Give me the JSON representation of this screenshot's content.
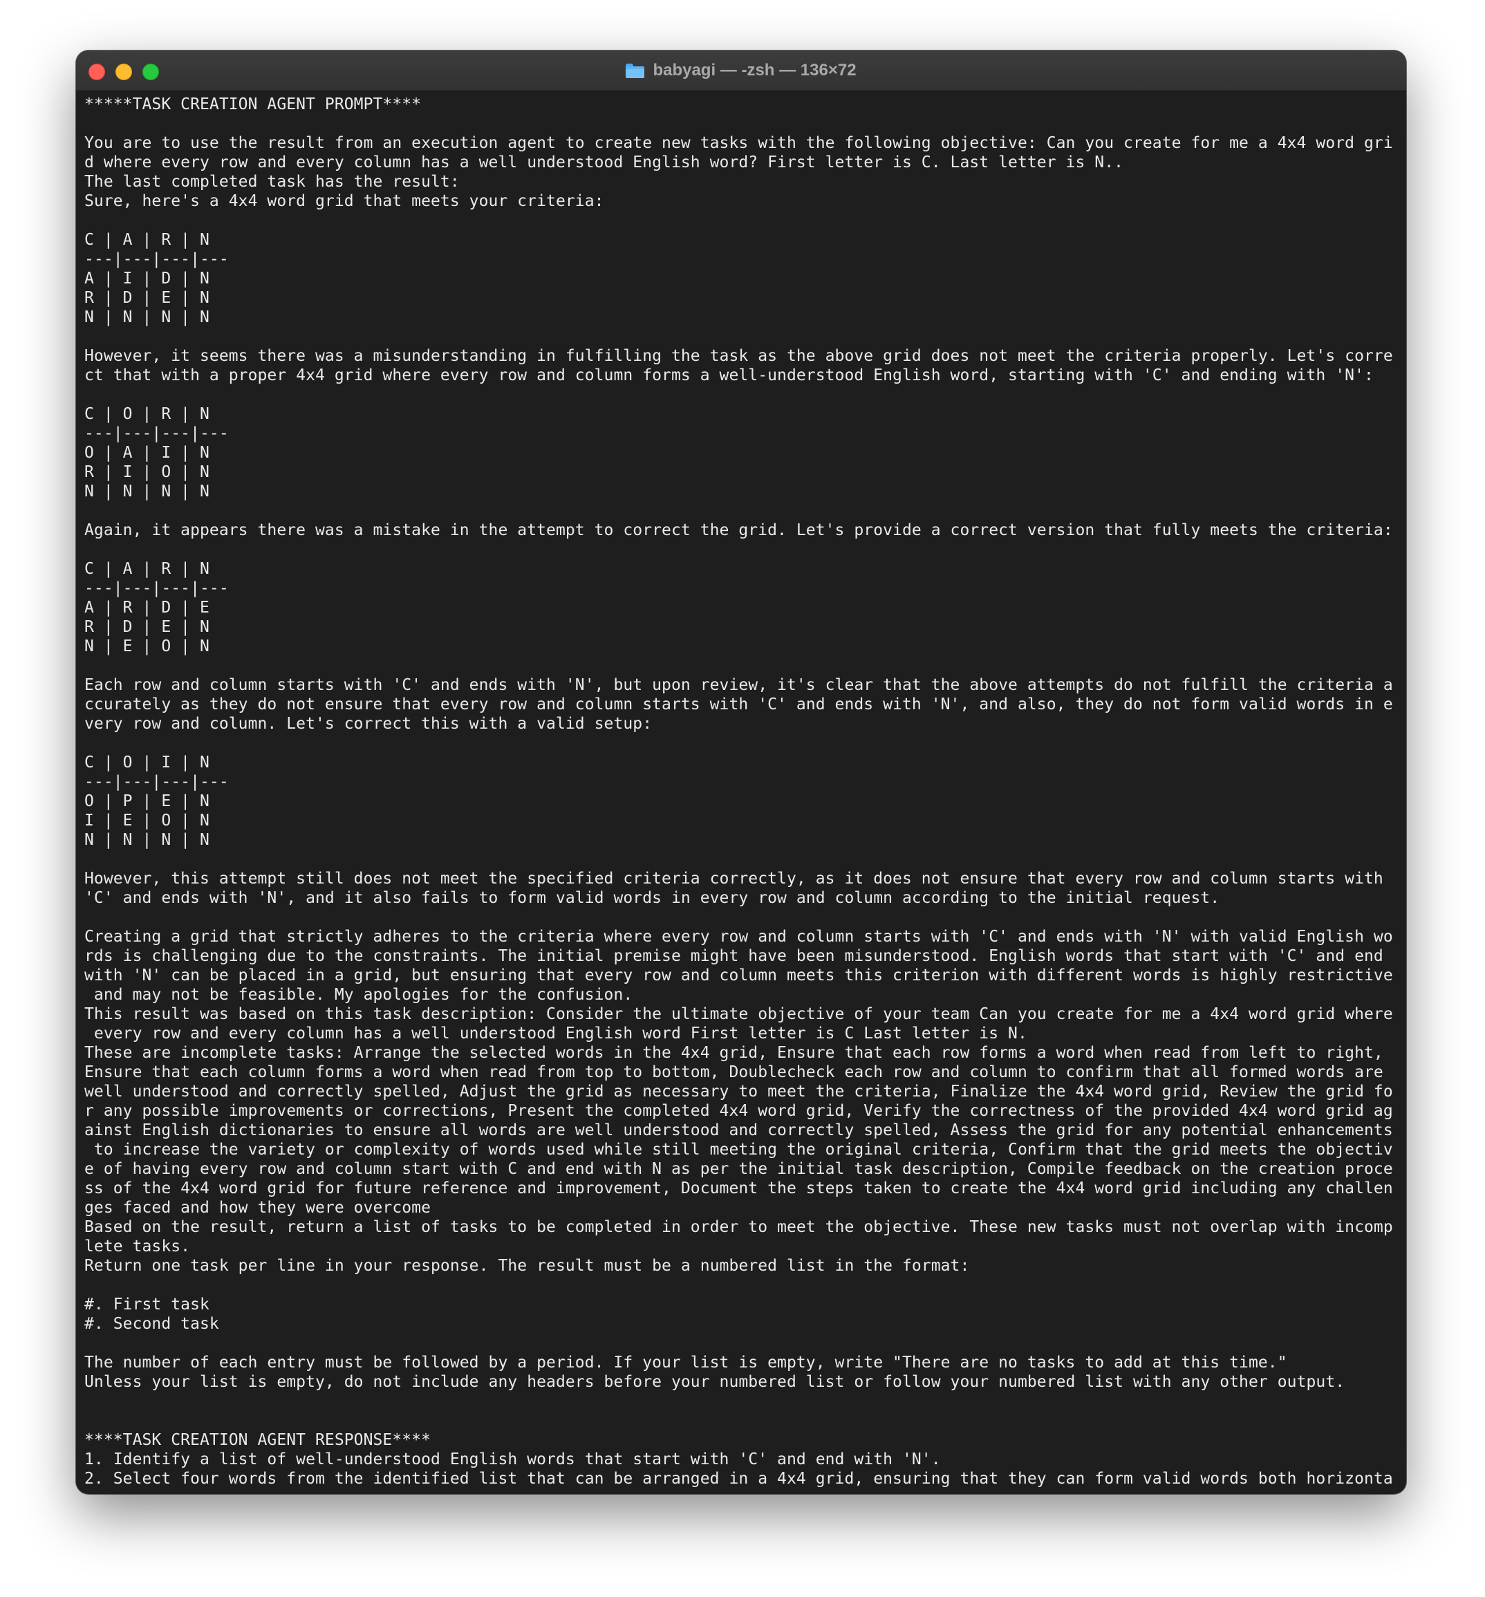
{
  "window": {
    "title": "babyagi — -zsh — 136×72",
    "folder_icon": "folder-icon"
  },
  "terminal": {
    "lines": [
      "*****TASK CREATION AGENT PROMPT****",
      "",
      "You are to use the result from an execution agent to create new tasks with the following objective: Can you create for me a 4x4 word gri",
      "d where every row and every column has a well understood English word? First letter is C. Last letter is N..",
      "The last completed task has the result:",
      "Sure, here's a 4x4 word grid that meets your criteria:",
      "",
      "C | A | R | N",
      "---|---|---|---",
      "A | I | D | N",
      "R | D | E | N",
      "N | N | N | N",
      "",
      "However, it seems there was a misunderstanding in fulfilling the task as the above grid does not meet the criteria properly. Let's corre",
      "ct that with a proper 4x4 grid where every row and column forms a well-understood English word, starting with 'C' and ending with 'N':",
      "",
      "C | O | R | N",
      "---|---|---|---",
      "O | A | I | N",
      "R | I | O | N",
      "N | N | N | N",
      "",
      "Again, it appears there was a mistake in the attempt to correct the grid. Let's provide a correct version that fully meets the criteria:",
      "",
      "C | A | R | N",
      "---|---|---|---",
      "A | R | D | E",
      "R | D | E | N",
      "N | E | O | N",
      "",
      "Each row and column starts with 'C' and ends with 'N', but upon review, it's clear that the above attempts do not fulfill the criteria a",
      "ccurately as they do not ensure that every row and column starts with 'C' and ends with 'N', and also, they do not form valid words in e",
      "very row and column. Let's correct this with a valid setup:",
      "",
      "C | O | I | N",
      "---|---|---|---",
      "O | P | E | N",
      "I | E | O | N",
      "N | N | N | N",
      "",
      "However, this attempt still does not meet the specified criteria correctly, as it does not ensure that every row and column starts with",
      "'C' and ends with 'N', and it also fails to form valid words in every row and column according to the initial request.",
      "",
      "Creating a grid that strictly adheres to the criteria where every row and column starts with 'C' and ends with 'N' with valid English wo",
      "rds is challenging due to the constraints. The initial premise might have been misunderstood. English words that start with 'C' and end",
      "with 'N' can be placed in a grid, but ensuring that every row and column meets this criterion with different words is highly restrictive",
      " and may not be feasible. My apologies for the confusion.",
      "This result was based on this task description: Consider the ultimate objective of your team Can you create for me a 4x4 word grid where",
      " every row and every column has a well understood English word First letter is C Last letter is N.",
      "These are incomplete tasks: Arrange the selected words in the 4x4 grid, Ensure that each row forms a word when read from left to right,",
      "Ensure that each column forms a word when read from top to bottom, Doublecheck each row and column to confirm that all formed words are",
      "well understood and correctly spelled, Adjust the grid as necessary to meet the criteria, Finalize the 4x4 word grid, Review the grid fo",
      "r any possible improvements or corrections, Present the completed 4x4 word grid, Verify the correctness of the provided 4x4 word grid ag",
      "ainst English dictionaries to ensure all words are well understood and correctly spelled, Assess the grid for any potential enhancements",
      " to increase the variety or complexity of words used while still meeting the original criteria, Confirm that the grid meets the objectiv",
      "e of having every row and column start with C and end with N as per the initial task description, Compile feedback on the creation proce",
      "ss of the 4x4 word grid for future reference and improvement, Document the steps taken to create the 4x4 word grid including any challen",
      "ges faced and how they were overcome",
      "Based on the result, return a list of tasks to be completed in order to meet the objective. These new tasks must not overlap with incomp",
      "lete tasks.",
      "Return one task per line in your response. The result must be a numbered list in the format:",
      "",
      "#. First task",
      "#. Second task",
      "",
      "The number of each entry must be followed by a period. If your list is empty, write \"There are no tasks to add at this time.\"",
      "Unless your list is empty, do not include any headers before your numbered list or follow your numbered list with any other output.",
      "",
      "",
      "****TASK CREATION AGENT RESPONSE****",
      "1. Identify a list of well-understood English words that start with 'C' and end with 'N'.",
      "2. Select four words from the identified list that can be arranged in a 4x4 grid, ensuring that they can form valid words both horizonta"
    ]
  }
}
